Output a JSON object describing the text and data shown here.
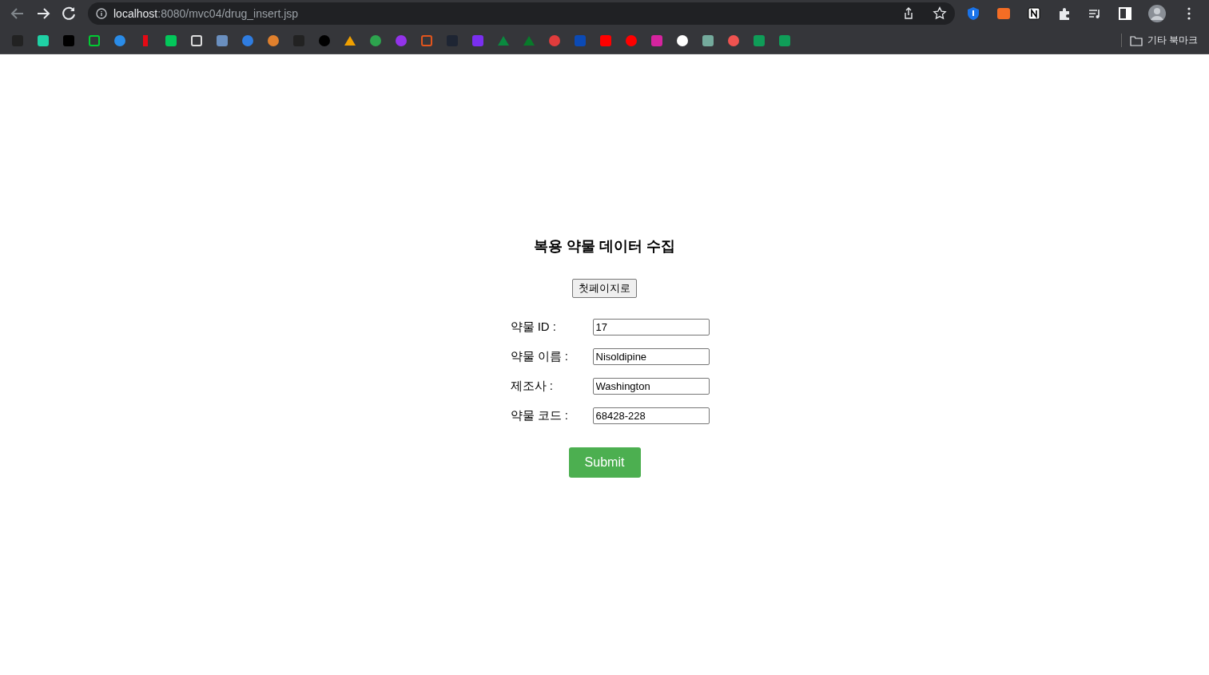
{
  "browser": {
    "url_host": "localhost",
    "url_path": ":8080/mvc04/drug_insert.jsp",
    "other_bookmarks": "기타 북마크"
  },
  "page": {
    "title": "복용 약물 데이터 수집",
    "home_button": "첫페이지로",
    "fields": [
      {
        "label": "약물 ID :",
        "value": "17"
      },
      {
        "label": "약물 이름 :",
        "value": "Nisoldipine"
      },
      {
        "label": "제조사 :",
        "value": "Washington"
      },
      {
        "label": "약물 코드 :",
        "value": "68428-228"
      }
    ],
    "submit": "Submit"
  }
}
